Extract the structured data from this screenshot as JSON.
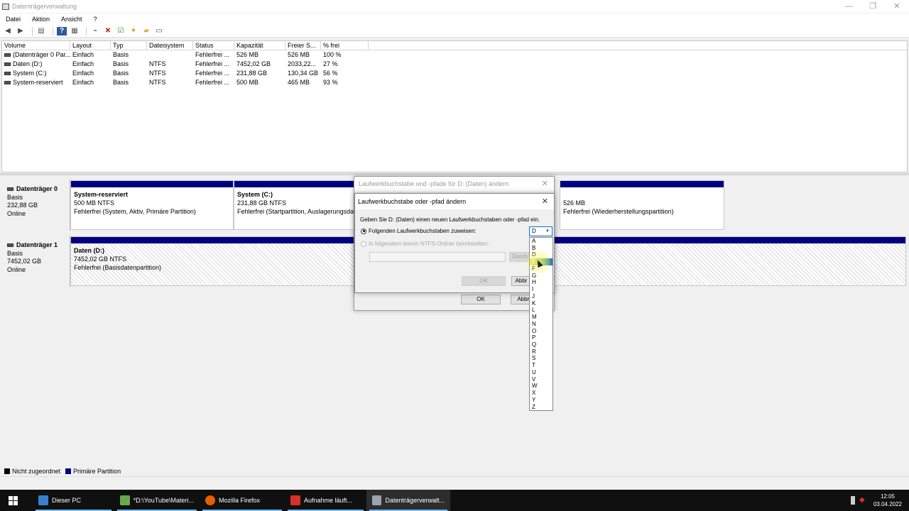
{
  "window": {
    "title": "Datenträgerverwaltung",
    "controls": [
      "—",
      "❐",
      "✕"
    ]
  },
  "menu": [
    "Datei",
    "Aktion",
    "Ansicht",
    "?"
  ],
  "toolbar_icons": [
    "back-icon",
    "forward-icon",
    "properties-icon",
    "help-icon",
    "list-icon",
    "connect-icon",
    "delete-icon",
    "check-icon",
    "new-icon",
    "folder-icon",
    "view-icon"
  ],
  "volume_table": {
    "headers": [
      "Volume",
      "Layout",
      "Typ",
      "Dateisystem",
      "Status",
      "Kapazität",
      "Freier S...",
      "% frei"
    ],
    "rows": [
      [
        "(Datenträger 0 Par...",
        "Einfach",
        "Basis",
        "",
        "Fehlerfrei ...",
        "526 MB",
        "526 MB",
        "100 %"
      ],
      [
        "Daten (D:)",
        "Einfach",
        "Basis",
        "NTFS",
        "Fehlerfrei ...",
        "7452,02 GB",
        "2033,22...",
        "27 %"
      ],
      [
        "System (C:)",
        "Einfach",
        "Basis",
        "NTFS",
        "Fehlerfrei ...",
        "231,88 GB",
        "130,34 GB",
        "56 %"
      ],
      [
        "System-reserviert",
        "Einfach",
        "Basis",
        "NTFS",
        "Fehlerfrei ...",
        "500 MB",
        "465 MB",
        "93 %"
      ]
    ]
  },
  "disks": [
    {
      "name": "Datenträger 0",
      "type": "Basis",
      "size": "232,88 GB",
      "status": "Online",
      "partitions": [
        {
          "title": "System-reserviert",
          "line1": "500 MB NTFS",
          "line2": "Fehlerfrei (System, Aktiv, Primäre Partition)"
        },
        {
          "title": "System  (C:)",
          "line1": "231,88 GB NTFS",
          "line2": "Fehlerfrei (Startpartition, Auslagerungsda"
        },
        {
          "title": "",
          "line1": "526 MB",
          "line2": "Fehlerfrei (Wiederherstellungspartition)"
        }
      ]
    },
    {
      "name": "Datenträger 1",
      "type": "Basis",
      "size": "7452,02 GB",
      "status": "Online",
      "partitions": [
        {
          "title": "Daten  (D:)",
          "line1": "7452,02 GB NTFS",
          "line2": "Fehlerfrei (Basisdatenpartition)"
        }
      ]
    }
  ],
  "legend": [
    {
      "label": "Nicht zugeordnet",
      "color": "#000000"
    },
    {
      "label": "Primäre Partition",
      "color": "#000080"
    }
  ],
  "back_dialog": {
    "title": "Laufwerkbuchstabe und -pfade für D: (Daten) ändern",
    "ok": "OK",
    "cancel": "Abbre"
  },
  "front_dialog": {
    "title": "Laufwerkbuchstabe oder -pfad ändern",
    "description": "Geben Sie D: (Daten) einen neuen Laufwerkbuchstaben oder -pfad ein.",
    "option_letter": "Folgenden Laufwerkbuchstaben zuweisen:",
    "option_folder": "In folgendem leeren NTFS-Ordner bereitstellen:",
    "browse": "Durch",
    "ok": "OK",
    "cancel": "Abbr",
    "selected_letter": "D",
    "letters": [
      "A",
      "B",
      "D",
      "E",
      "F",
      "G",
      "H",
      "I",
      "J",
      "K",
      "L",
      "M",
      "N",
      "O",
      "P",
      "Q",
      "R",
      "S",
      "T",
      "U",
      "V",
      "W",
      "X",
      "Y",
      "Z"
    ],
    "hovered_letter": "E"
  },
  "taskbar": {
    "items": [
      {
        "label": "Dieser PC",
        "color": "#3a7fd0"
      },
      {
        "label": "*D:\\YouTube\\Materi...",
        "color": "#6aa84f"
      },
      {
        "label": "Mozilla Firefox",
        "color": "#e66000"
      },
      {
        "label": "Aufnahme läuft...",
        "color": "#d8302a"
      },
      {
        "label": "Datenträgerverwalt...",
        "color": "#9aa4ae"
      }
    ],
    "time": "12:05",
    "date": "03.04.2022"
  }
}
